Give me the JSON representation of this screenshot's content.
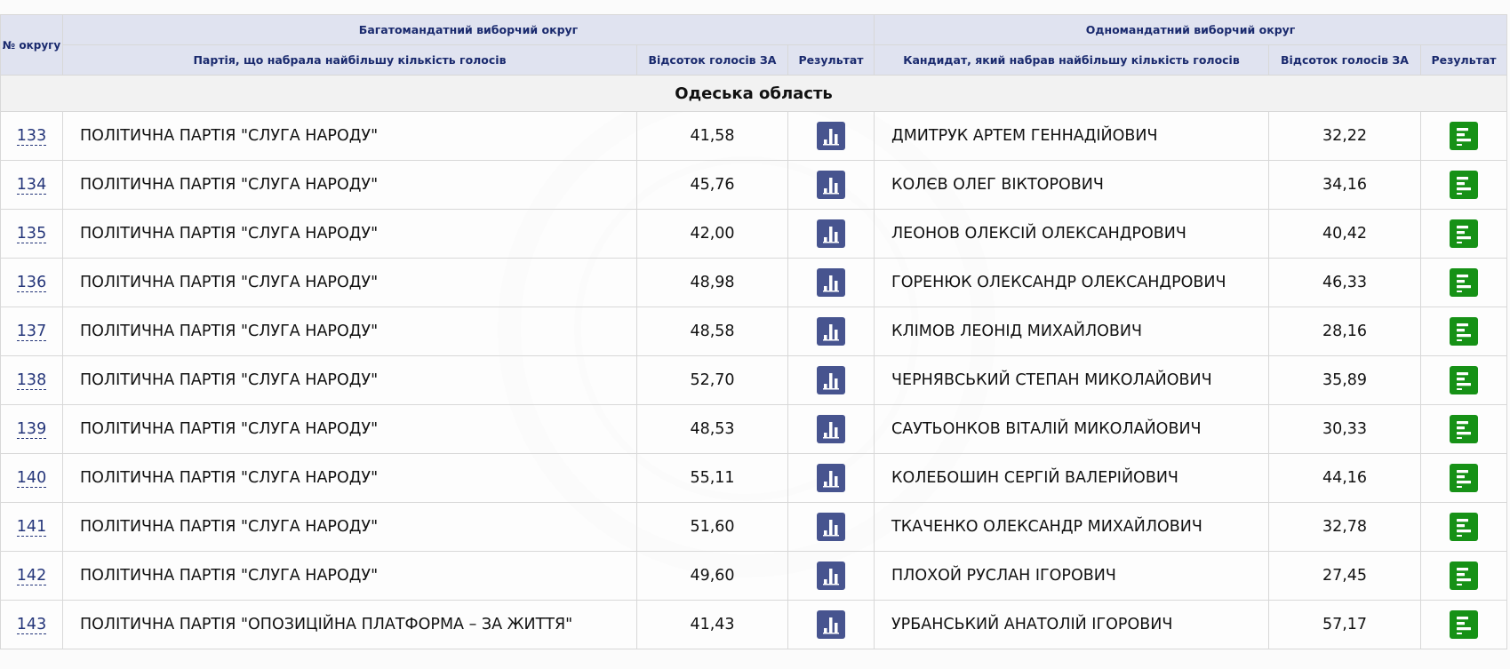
{
  "header": {
    "district_no": "№ округу",
    "multi_mandate": "Багатомандатний виборчий округ",
    "single_mandate": "Одномандатний виборчий округ",
    "party_col": "Партія, що набрала найбільшу кількість голосів",
    "pct_col": "Відсоток голосів ЗА",
    "result_col": "Результат",
    "candidate_col": "Кандидат, який набрав найбільшу кількість голосів",
    "pct_col2": "Відсоток голосів ЗА",
    "result_col2": "Результат"
  },
  "region": "Одеська область",
  "icons": {
    "party_result": "bar-chart-icon",
    "candidate_result": "result-list-icon"
  },
  "colors": {
    "header_bg": "#e0e3f0",
    "chart_button": "#47548f",
    "result_button": "#169116",
    "link": "#25367a"
  },
  "rows": [
    {
      "num": "133",
      "party": "ПОЛІТИЧНА ПАРТІЯ \"СЛУГА НАРОДУ\"",
      "party_pct": "41,58",
      "candidate": "ДМИТРУК АРТЕМ ГЕННАДІЙОВИЧ",
      "cand_pct": "32,22"
    },
    {
      "num": "134",
      "party": "ПОЛІТИЧНА ПАРТІЯ \"СЛУГА НАРОДУ\"",
      "party_pct": "45,76",
      "candidate": "КОЛЄВ ОЛЕГ ВІКТОРОВИЧ",
      "cand_pct": "34,16"
    },
    {
      "num": "135",
      "party": "ПОЛІТИЧНА ПАРТІЯ \"СЛУГА НАРОДУ\"",
      "party_pct": "42,00",
      "candidate": "ЛЕОНОВ ОЛЕКСІЙ ОЛЕКСАНДРОВИЧ",
      "cand_pct": "40,42"
    },
    {
      "num": "136",
      "party": "ПОЛІТИЧНА ПАРТІЯ \"СЛУГА НАРОДУ\"",
      "party_pct": "48,98",
      "candidate": "ГОРЕНЮК ОЛЕКСАНДР ОЛЕКСАНДРОВИЧ",
      "cand_pct": "46,33"
    },
    {
      "num": "137",
      "party": "ПОЛІТИЧНА ПАРТІЯ \"СЛУГА НАРОДУ\"",
      "party_pct": "48,58",
      "candidate": "КЛІМОВ ЛЕОНІД МИХАЙЛОВИЧ",
      "cand_pct": "28,16"
    },
    {
      "num": "138",
      "party": "ПОЛІТИЧНА ПАРТІЯ \"СЛУГА НАРОДУ\"",
      "party_pct": "52,70",
      "candidate": "ЧЕРНЯВСЬКИЙ СТЕПАН МИКОЛАЙОВИЧ",
      "cand_pct": "35,89"
    },
    {
      "num": "139",
      "party": "ПОЛІТИЧНА ПАРТІЯ \"СЛУГА НАРОДУ\"",
      "party_pct": "48,53",
      "candidate": "САУТЬОНКОВ ВІТАЛІЙ МИКОЛАЙОВИЧ",
      "cand_pct": "30,33"
    },
    {
      "num": "140",
      "party": "ПОЛІТИЧНА ПАРТІЯ \"СЛУГА НАРОДУ\"",
      "party_pct": "55,11",
      "candidate": "КОЛЕБОШИН СЕРГІЙ ВАЛЕРІЙОВИЧ",
      "cand_pct": "44,16"
    },
    {
      "num": "141",
      "party": "ПОЛІТИЧНА ПАРТІЯ \"СЛУГА НАРОДУ\"",
      "party_pct": "51,60",
      "candidate": "ТКАЧЕНКО ОЛЕКСАНДР МИХАЙЛОВИЧ",
      "cand_pct": "32,78"
    },
    {
      "num": "142",
      "party": "ПОЛІТИЧНА ПАРТІЯ \"СЛУГА НАРОДУ\"",
      "party_pct": "49,60",
      "candidate": "ПЛОХОЙ РУСЛАН ІГОРОВИЧ",
      "cand_pct": "27,45"
    },
    {
      "num": "143",
      "party": "ПОЛІТИЧНА ПАРТІЯ \"ОПОЗИЦІЙНА ПЛАТФОРМА – ЗА ЖИТТЯ\"",
      "party_pct": "41,43",
      "candidate": "УРБАНСЬКИЙ АНАТОЛІЙ ІГОРОВИЧ",
      "cand_pct": "57,17"
    }
  ]
}
